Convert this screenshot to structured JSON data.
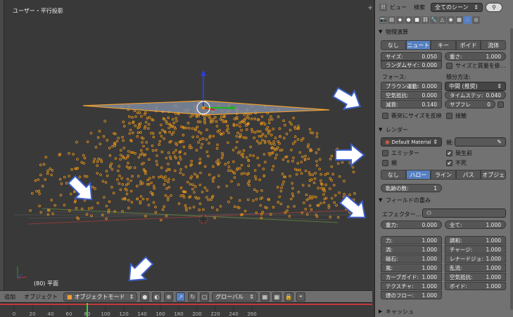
{
  "viewport": {
    "title": "ユーザー・平行投影",
    "frame_info": "(80) 平面"
  },
  "header3d": {
    "menu_add": "追加",
    "menu_object": "オブジェクト",
    "mode": "オブジェクトモード",
    "orientation": "グローバル"
  },
  "timeline": {
    "ticks": [
      "0",
      "20",
      "40",
      "60",
      "80",
      "100",
      "120",
      "140",
      "160",
      "180",
      "200",
      "220",
      "240",
      "260"
    ],
    "current_frame": "80"
  },
  "props": {
    "header": {
      "view": "ビュー",
      "search": "検索",
      "scene_select": "全てのシーン"
    },
    "physics": {
      "title": "物理演算",
      "types": [
        "なし",
        "ニュート",
        "キー",
        "ボイド",
        "流体"
      ],
      "active_type": "ニュート",
      "size_label": "サイズ:",
      "size_value": "0.050",
      "mass_label": "重さ:",
      "mass_value": "1.000",
      "random_size_label": "ランダムサイ:",
      "random_size_value": "0.000",
      "mass_by_size": "サイズと質量を掛…",
      "forces_label": "フォース:",
      "integration_label": "積分方法:",
      "brownian_label": "ブラウン運動:",
      "brownian_value": "0.000",
      "drag_label": "空気抵抗:",
      "drag_value": "0.000",
      "damp_label": "減衰:",
      "damp_value": "0.140",
      "integrator": "中間 (推奨)",
      "timestep_label": "タイムステッ:",
      "timestep_value": "0.040",
      "subframes_label": "サブフレ",
      "subframes_value": "0",
      "size_deflect": "衝突にサイズを反映",
      "die_on_hit": "接触"
    },
    "render": {
      "title": "レンダー",
      "material": "Default Material",
      "parent_label": "親:",
      "emitter": "エミッター",
      "parents": "親",
      "unborn": "発生前",
      "died": "不死",
      "unborn_checked": true,
      "died_checked": true,
      "types": [
        "なし",
        "ハロー",
        "ライン",
        "パス",
        "オブジェ"
      ],
      "active_type": "ハロー",
      "trail_label": "軌跡の数:",
      "trail_value": "1"
    },
    "field_weights": {
      "title": "フィールドの重み",
      "effector_label": "エフェクター…",
      "gravity_label": "重力:",
      "gravity_value": "0.000",
      "all_label": "全て:",
      "all_value": "1.000",
      "left": [
        {
          "label": "力:",
          "value": "1.000"
        },
        {
          "label": "渦:",
          "value": "1.000"
        },
        {
          "label": "磁石:",
          "value": "1.000"
        },
        {
          "label": "風:",
          "value": "1.000"
        },
        {
          "label": "カーブガイド:",
          "value": "1.000"
        },
        {
          "label": "テクスチャ:",
          "value": "1.000"
        },
        {
          "label": "煙のフロー:",
          "value": "1.000"
        }
      ],
      "right": [
        {
          "label": "調和:",
          "value": "1.000"
        },
        {
          "label": "チャージ:",
          "value": "1.000"
        },
        {
          "label": "レナードジョ:",
          "value": "1.000"
        },
        {
          "label": "乱流:",
          "value": "1.000"
        },
        {
          "label": "空気抵抗:",
          "value": "1.000"
        },
        {
          "label": "ボイド:",
          "value": "1.000"
        }
      ]
    },
    "cache": {
      "title": "キャッシュ"
    }
  },
  "colors": {
    "accent": "#5680c2",
    "particle": "#e8941a",
    "plane_outline": "#f0a030"
  }
}
